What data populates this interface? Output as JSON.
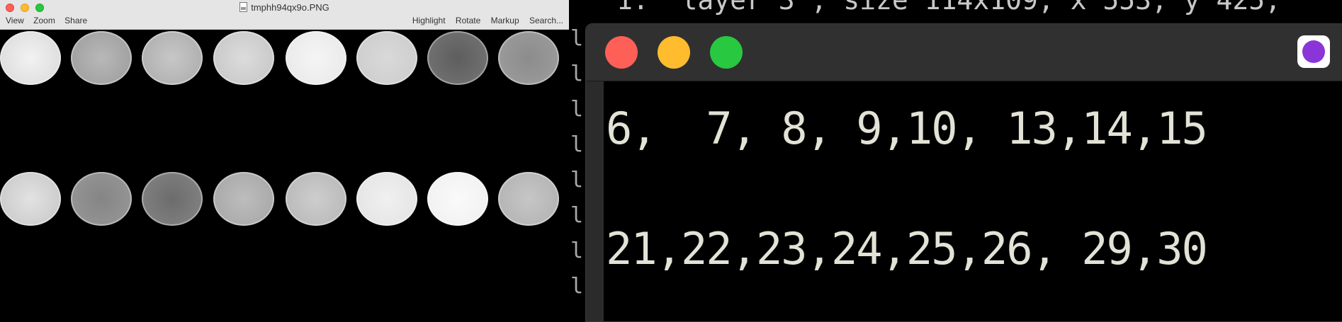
{
  "preview": {
    "title": "tmphh94qx9o.PNG",
    "menu_left": [
      "View",
      "Zoom",
      "Share"
    ],
    "menu_right": [
      "Highlight",
      "Rotate",
      "Markup",
      "Search..."
    ]
  },
  "background_terminal": {
    "text": "1.  layer 3 , size 114x109, x 553, y 425,"
  },
  "terminal": {
    "lines": [
      "6,  7, 8, 9,10, 13,14,15",
      "21,22,23,24,25,26, 29,30"
    ]
  },
  "colors": {
    "close": "#fe5f57",
    "minimize": "#febc2e",
    "zoom": "#28c840",
    "terminal_text": "#e2e2d6"
  }
}
